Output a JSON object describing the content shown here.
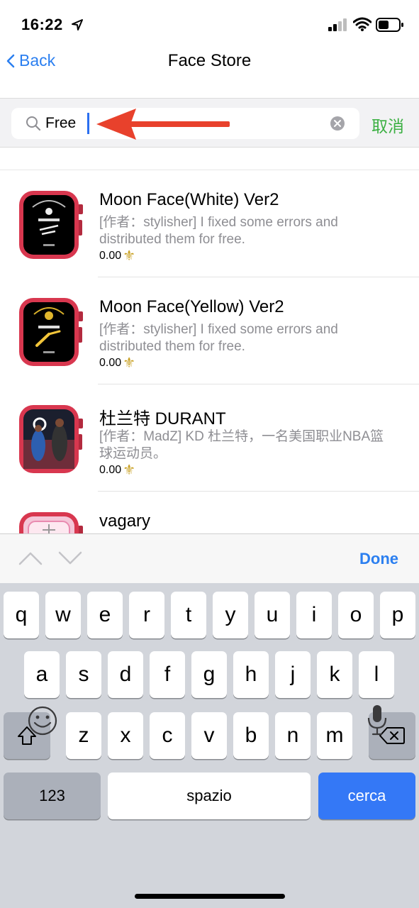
{
  "status_bar": {
    "time": "16:22",
    "icons": [
      "location-arrow-icon",
      "cellular-signal-icon",
      "wifi-icon",
      "battery-icon"
    ]
  },
  "nav": {
    "back_label": "Back",
    "title": "Face Store"
  },
  "search": {
    "value": "Free",
    "cancel_label": "取消",
    "accent": "#3cb043"
  },
  "items": [
    {
      "name": "Moon Face(White) Ver2",
      "description": "[作者：stylisher] I fixed some errors and distributed them for free.",
      "price": "0.00",
      "price_icon": "fleur-de-lis-icon"
    },
    {
      "name": "Moon Face(Yellow) Ver2",
      "description": "[作者：stylisher] I fixed some errors and distributed them for free.",
      "price": "0.00",
      "price_icon": "fleur-de-lis-icon"
    },
    {
      "name": "杜兰特 DURANT",
      "description": "[作者：MadZ] KD 杜兰特，一名美国职业NBA篮球运动员。",
      "price": "0.00",
      "price_icon": "fleur-de-lis-icon"
    },
    {
      "name": "vagary",
      "description": "",
      "price": ""
    }
  ],
  "accessory": {
    "done_label": "Done"
  },
  "keyboard": {
    "row1": [
      "q",
      "w",
      "e",
      "r",
      "t",
      "y",
      "u",
      "i",
      "o",
      "p"
    ],
    "row2": [
      "a",
      "s",
      "d",
      "f",
      "g",
      "h",
      "j",
      "k",
      "l"
    ],
    "row3": [
      "z",
      "x",
      "c",
      "v",
      "b",
      "n",
      "m"
    ],
    "numbers_label": "123",
    "space_label": "spazio",
    "search_label": "cerca"
  },
  "colors": {
    "link_blue": "#2b7ff0",
    "key_blue": "#3478f6",
    "arrow_red": "#e8412c"
  }
}
